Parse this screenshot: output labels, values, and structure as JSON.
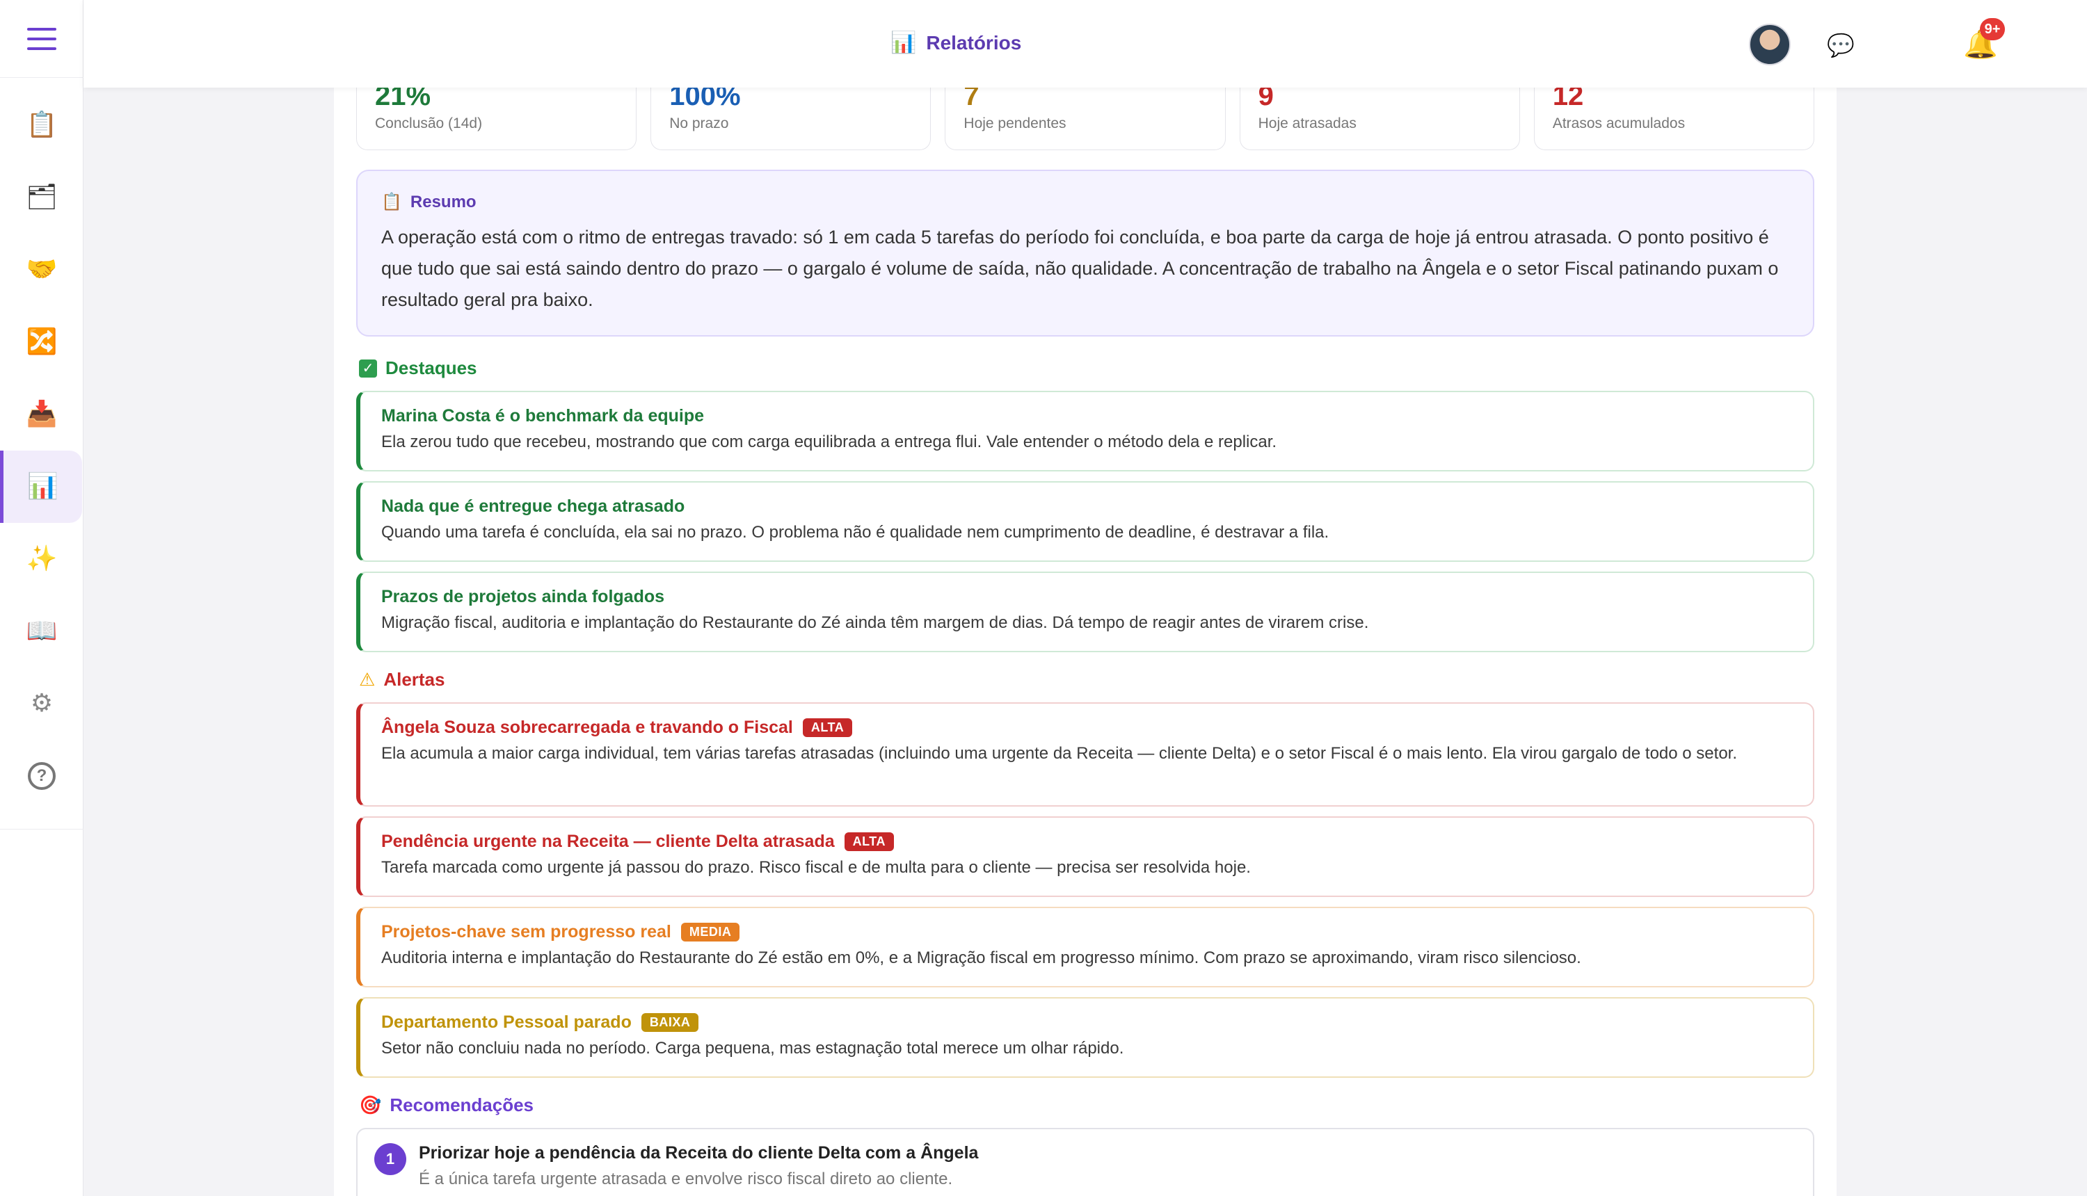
{
  "header": {
    "title": "Relatórios",
    "title_icon": "bar-chart-icon",
    "notifications_badge": "9+"
  },
  "sidebar": {
    "items": [
      {
        "icon": "clipboard-icon",
        "glyph": "📋"
      },
      {
        "icon": "folder-icon",
        "glyph": "🗂"
      },
      {
        "icon": "handshake-icon",
        "glyph": "🤝"
      },
      {
        "icon": "shuffle-icon",
        "glyph": "🔀"
      },
      {
        "icon": "inbox-icon",
        "glyph": "📥"
      },
      {
        "icon": "bar-chart-icon",
        "glyph": "📊",
        "active": true
      },
      {
        "icon": "sparkles-icon",
        "glyph": "✨"
      },
      {
        "icon": "book-icon",
        "glyph": "📖"
      },
      {
        "icon": "gear-icon",
        "glyph": "⚙"
      }
    ]
  },
  "stats": [
    {
      "value": "21%",
      "label": "Conclusão (14d)",
      "color": "#1e7a3a"
    },
    {
      "value": "100%",
      "label": "No prazo",
      "color": "#1a5fb4"
    },
    {
      "value": "7",
      "label": "Hoje pendentes",
      "color": "#b07d12"
    },
    {
      "value": "9",
      "label": "Hoje atrasadas",
      "color": "#c62828"
    },
    {
      "value": "12",
      "label": "Atrasos acumulados",
      "color": "#c62828"
    }
  ],
  "resumo": {
    "title": "Resumo",
    "text": "A operação está com o ritmo de entregas travado: só 1 em cada 5 tarefas do período foi concluída, e boa parte da carga de hoje já entrou atrasada. O ponto positivo é que tudo que sai está saindo dentro do prazo — o gargalo é volume de saída, não qualidade. A concentração de trabalho na Ângela e o setor Fiscal patinando puxam o resultado geral pra baixo."
  },
  "destaques": {
    "title": "Destaques",
    "items": [
      {
        "title": "Marina Costa é o benchmark da equipe",
        "desc": "Ela zerou tudo que recebeu, mostrando que com carga equilibrada a entrega flui. Vale entender o método dela e replicar."
      },
      {
        "title": "Nada que é entregue chega atrasado",
        "desc": "Quando uma tarefa é concluída, ela sai no prazo. O problema não é qualidade nem cumprimento de deadline, é destravar a fila."
      },
      {
        "title": "Prazos de projetos ainda folgados",
        "desc": "Migração fiscal, auditoria e implantação do Restaurante do Zé ainda têm margem de dias. Dá tempo de reagir antes de virarem crise."
      }
    ]
  },
  "alertas": {
    "title": "Alertas",
    "items": [
      {
        "title": "Ângela Souza sobrecarregada e travando o Fiscal",
        "tag": "ALTA",
        "color": "#c62828",
        "desc": "Ela acumula a maior carga individual, tem várias tarefas atrasadas (incluindo uma urgente da Receita — cliente Delta) e o setor Fiscal é o mais lento. Ela virou gargalo de todo o setor."
      },
      {
        "title": "Pendência urgente na Receita — cliente Delta atrasada",
        "tag": "ALTA",
        "color": "#c62828",
        "desc": "Tarefa marcada como urgente já passou do prazo. Risco fiscal e de multa para o cliente — precisa ser resolvida hoje."
      },
      {
        "title": "Projetos-chave sem progresso real",
        "tag": "MEDIA",
        "color": "#e67e22",
        "desc": "Auditoria interna e implantação do Restaurante do Zé estão em 0%, e a Migração fiscal em progresso mínimo. Com prazo se aproximando, viram risco silencioso."
      },
      {
        "title": "Departamento Pessoal parado",
        "tag": "BAIXA",
        "color": "#c0930a",
        "desc": "Setor não concluiu nada no período. Carga pequena, mas estagnação total merece um olhar rápido."
      }
    ]
  },
  "recomendacoes": {
    "title": "Recomendações",
    "items": [
      {
        "num": "1",
        "title": "Priorizar hoje a pendência da Receita do cliente Delta com a Ângela",
        "desc": "É a única tarefa urgente atrasada e envolve risco fiscal direto ao cliente."
      }
    ]
  },
  "colors": {
    "accent": "#6b3fd0",
    "success": "#1e8a3e",
    "danger": "#c62828",
    "warning": "#e67e22",
    "low": "#c0930a"
  }
}
